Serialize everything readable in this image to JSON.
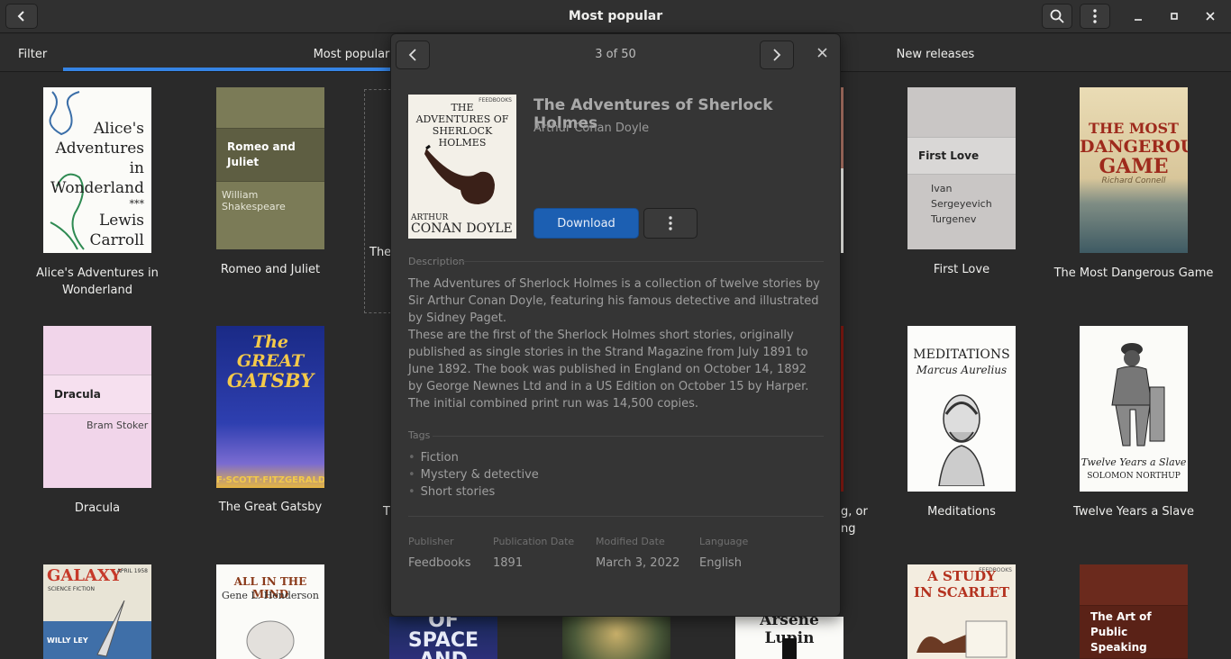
{
  "window": {
    "title": "Most popular",
    "back_icon": "go-back-icon",
    "search_icon": "search-icon",
    "menu_icon": "menu-icon",
    "minimize_icon": "minimize-icon",
    "maximize_icon": "maximize-icon",
    "close_icon": "close-icon"
  },
  "tabs": {
    "filter_label": "Filter",
    "items": [
      {
        "label": "Most popular",
        "active": true
      },
      {
        "label": "New releases",
        "active": false
      }
    ],
    "accent": "#3584e4"
  },
  "grid": {
    "books": [
      {
        "title": "Alice's Adventures in Wonderland",
        "cover_text": [
          "Alice's",
          "Adventures in",
          "Wonderland",
          "***",
          "Lewis",
          "Carroll"
        ]
      },
      {
        "title": "Romeo and Juliet",
        "cover_title": "Romeo and Juliet",
        "cover_author": "William Shakespeare",
        "cover_color": "#7b7b57"
      },
      {
        "title": "The"
      },
      {
        "title": "First Love",
        "cover_title": "First Love",
        "cover_author": "Ivan Sergeyevich Turgenev",
        "cover_color": "#c9c6c5"
      },
      {
        "title": "The Most Dangerous Game",
        "cover_text": [
          "THE MOST",
          "DANGEROUS",
          "GAME",
          "Richard Connell"
        ]
      },
      {
        "title": "Dracula",
        "cover_title": "Dracula",
        "cover_author": "Bram Stoker",
        "cover_color": "#f1d5ea"
      },
      {
        "title": "The Great Gatsby",
        "cover_text": [
          "The GREAT",
          "GATSBY",
          "F·SCOTT·FITZGERALD"
        ]
      },
      {
        "title": "T"
      },
      {
        "title_line1": "g, or",
        "title_line2": "ng"
      },
      {
        "title": "Meditations",
        "cover_text": [
          "MEDITATIONS",
          "Marcus Aurelius"
        ]
      },
      {
        "title": "Twelve Years a Slave",
        "cover_text": [
          "Twelve Years a Slave",
          "SOLOMON NORTHUP"
        ]
      },
      {
        "cover_text": [
          "GALAXY",
          "SCIENCE FICTION",
          "APRIL 1958",
          "WILLY LEY"
        ]
      },
      {
        "cover_text": [
          "ALL IN THE MIND",
          "Gene L. Henderson"
        ]
      },
      {
        "cover_text": [
          "OF",
          "SPACE",
          "AND"
        ]
      },
      {
        "cover_text": []
      },
      {
        "cover_text": [
          "Arsène Lupin"
        ]
      },
      {
        "cover_text": [
          "A STUDY",
          "IN SCARLET",
          "FEEDBOOKS"
        ]
      },
      {
        "cover_title": "The Art of Public Speaking",
        "cover_color": "#6b2a1d"
      }
    ]
  },
  "details": {
    "counter": "3 of 50",
    "prev_icon": "chevron-left-icon",
    "next_icon": "chevron-right-icon",
    "close_icon": "close-icon",
    "cover_text": [
      "FEEDBOOKS",
      "THE",
      "ADVENTURES OF",
      "SHERLOCK HOLMES",
      "ARTHUR",
      "CONAN DOYLE"
    ],
    "title": "The Adventures of Sherlock Holmes",
    "author": "Arthur Conan Doyle",
    "download_label": "Download",
    "more_icon": "more-vertical-icon",
    "description_heading": "Description",
    "description_p1": "The Adventures of Sherlock Holmes is a collection of twelve stories by Sir Arthur Conan Doyle, featuring his famous detective and illustrated by Sidney Paget.",
    "description_p2": "These are the first of the Sherlock Holmes short stories, originally published as single stories in the Strand Magazine from July 1891 to June 1892. The book was published in England on October 14, 1892 by George Newnes Ltd and in a US Edition on October 15 by Harper. The initial combined print run was 14,500 copies.",
    "tags_heading": "Tags",
    "tags": [
      "Fiction",
      "Mystery & detective",
      "Short stories"
    ],
    "meta": [
      {
        "label": "Publisher",
        "value": "Feedbooks"
      },
      {
        "label": "Publication Date",
        "value": "1891"
      },
      {
        "label": "Modified Date",
        "value": "March 3, 2022"
      },
      {
        "label": "Language",
        "value": "English"
      }
    ]
  }
}
